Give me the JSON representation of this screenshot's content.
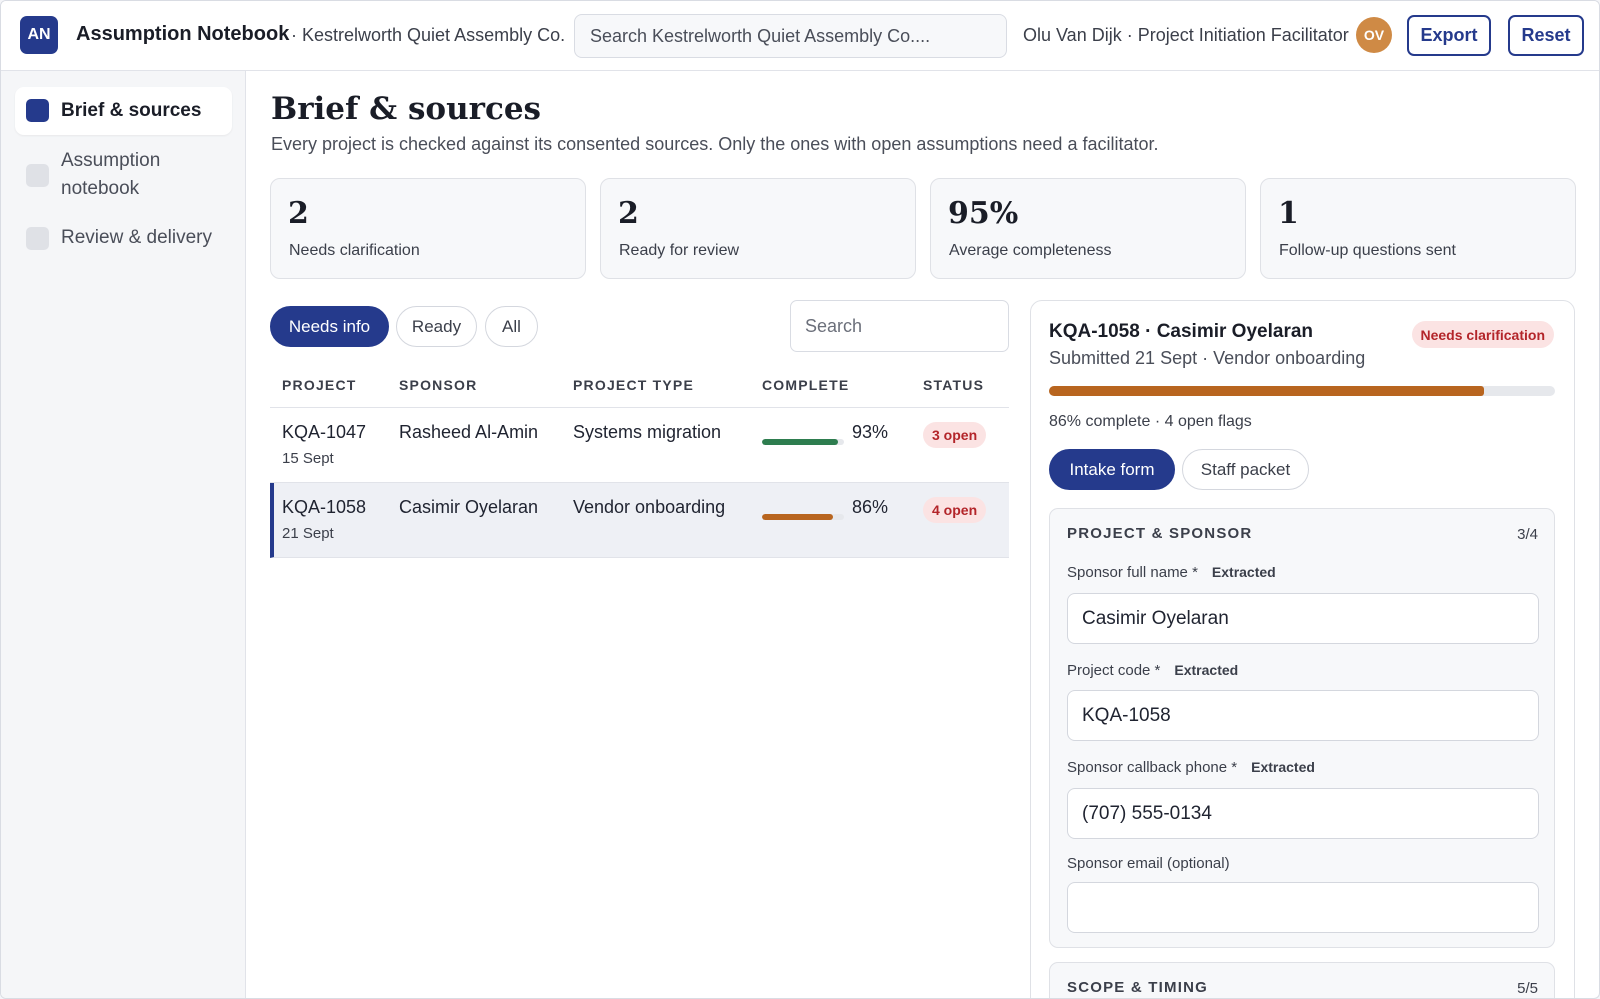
{
  "app": {
    "logo_text": "AN",
    "title": "Assumption Notebook",
    "org": "· Kestrelworth Quiet Assembly Co.",
    "search_placeholder": "Search Kestrelworth Quiet Assembly Co....",
    "user": "Olu Van Dijk · Project Initiation Facilitator",
    "avatar": "OV",
    "export_label": "Export",
    "reset_label": "Reset"
  },
  "sidebar": {
    "items": [
      {
        "label": "Brief & sources",
        "active": true
      },
      {
        "label": "Assumption notebook",
        "active": false
      },
      {
        "label": "Review & delivery",
        "active": false
      }
    ]
  },
  "main": {
    "title": "Brief & sources",
    "subtitle": "Every project is checked against its consented sources. Only the ones with open assumptions need a facilitator.",
    "stats": [
      {
        "value": "2",
        "label": "Needs clarification"
      },
      {
        "value": "2",
        "label": "Ready for review"
      },
      {
        "value": "95%",
        "label": "Average completeness"
      },
      {
        "value": "1",
        "label": "Follow-up questions sent"
      }
    ],
    "filters": [
      "Needs info",
      "Ready",
      "All"
    ],
    "list_search_placeholder": "Search",
    "table": {
      "headers": [
        "PROJECT",
        "SPONSOR",
        "PROJECT TYPE",
        "COMPLETE",
        "STATUS"
      ],
      "rows": [
        {
          "id": "KQA-1047",
          "date": "15 Sept",
          "sponsor": "Rasheed Al-Amin",
          "type": "Systems migration",
          "complete": 93,
          "complete_text": "93%",
          "status": "3 open",
          "bar_color": "#2e7d4f",
          "selected": false
        },
        {
          "id": "KQA-1058",
          "date": "21 Sept",
          "sponsor": "Casimir Oyelaran",
          "type": "Vendor onboarding",
          "complete": 86,
          "complete_text": "86%",
          "status": "4 open",
          "bar_color": "#b8651f",
          "selected": true
        }
      ]
    }
  },
  "detail": {
    "title": "KQA-1058 · Casimir Oyelaran",
    "badge": "Needs clarification",
    "subtitle": "Submitted 21 Sept · Vendor onboarding",
    "progress": 86,
    "progress_text": "86% complete · 4 open flags",
    "tabs": [
      "Intake form",
      "Staff packet"
    ],
    "sections": [
      {
        "title": "PROJECT & SPONSOR",
        "count": "3/4",
        "fields": [
          {
            "label": "Sponsor full name *",
            "tag": "Extracted",
            "value": "Casimir Oyelaran"
          },
          {
            "label": "Project code *",
            "tag": "Extracted",
            "value": "KQA-1058"
          },
          {
            "label": "Sponsor callback phone *",
            "tag": "Extracted",
            "value": "(707) 555-0134"
          },
          {
            "label": "Sponsor email (optional)",
            "tag": "",
            "value": ""
          }
        ]
      },
      {
        "title": "SCOPE & TIMING",
        "count": "5/5"
      }
    ]
  },
  "colors": {
    "accent": "#253a8c",
    "avatar": "#cf8a45",
    "badge_bg": "#fbe3e3",
    "badge_text": "#b3252a"
  }
}
